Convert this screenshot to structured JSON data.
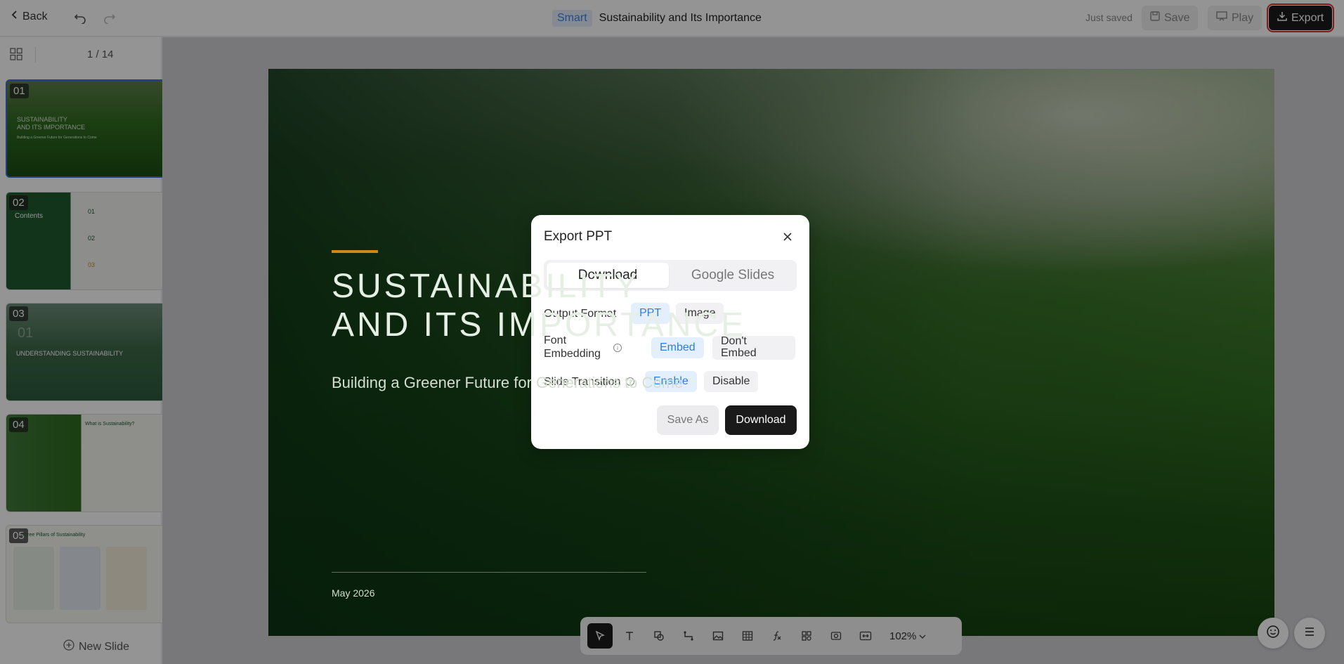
{
  "header": {
    "back_label": "Back",
    "badge": "Smart",
    "title": "Sustainability and Its Importance",
    "status": "Just saved",
    "save_label": "Save",
    "play_label": "Play",
    "export_label": "Export"
  },
  "sidebar": {
    "page_indicator": "1 / 14",
    "new_slide_label": "New Slide",
    "thumbnails": [
      {
        "num": "01",
        "title": "SUSTAINABILITY\nAND ITS IMPORTANCE",
        "sub": "Building a Greener Future for Generations to Come"
      },
      {
        "num": "02",
        "title": "Contents",
        "items": [
          "01",
          "02",
          "03"
        ]
      },
      {
        "num": "03",
        "big": "01",
        "title": "UNDERSTANDING SUSTAINABILITY"
      },
      {
        "num": "04",
        "title": "What is Sustainability?"
      },
      {
        "num": "05",
        "title": "Three Pillars of Sustainability"
      }
    ]
  },
  "slide": {
    "title": "SUSTAINABILITY\nAND ITS IMPORTANCE",
    "subtitle": "Building a Greener Future for Generations to Come",
    "date": "May 2026"
  },
  "toolbar": {
    "zoom": "102%"
  },
  "modal": {
    "title": "Export PPT",
    "tabs": [
      "Download",
      "Google Slides"
    ],
    "output_format_label": "Output Format",
    "output_format_options": [
      "PPT",
      "Image"
    ],
    "font_embedding_label": "Font\nEmbedding",
    "font_embedding_options": [
      "Embed",
      "Don't\nEmbed"
    ],
    "slide_transition_label": "Slide Transition",
    "slide_transition_options": [
      "Enable",
      "Disable"
    ],
    "save_as_label": "Save As",
    "download_label": "Download"
  }
}
